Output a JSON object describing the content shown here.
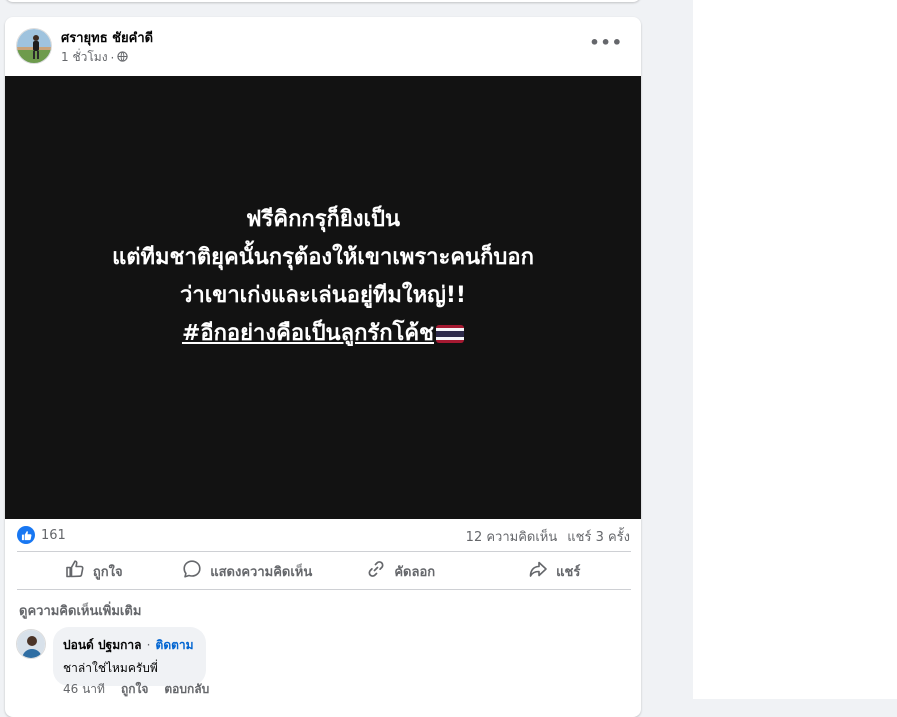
{
  "post": {
    "author": "ศรายุทธ ชัยคำดี",
    "time": "1 ชั่วโมง",
    "time_sep": "·",
    "audience_icon": "globe-icon",
    "more_icon": "more-horizontal-icon",
    "media_lines": [
      "ฟรีคิกกรุก็ยิงเป็น",
      "แต่ทีมชาติยุคนั้นกรุต้องให้เขาเพราะคนก็บอก",
      "ว่าเขาเก่งและเล่นอยู่ทีมใหญ่!!"
    ],
    "media_hashtag": "#อีกอย่างคือเป็นลูกรักโค้ช",
    "reaction_count": "161",
    "comments_count": "12 ความคิดเห็น",
    "shares_count": "แชร์ 3 ครั้ง"
  },
  "actions": {
    "like": "ถูกใจ",
    "comment": "แสดงความคิดเห็น",
    "copy": "คัดลอก",
    "share": "แชร์"
  },
  "comments": {
    "more_label": "ดูความคิดเห็นเพิ่มเติม",
    "items": [
      {
        "author": "ปอนด์ ปฐมกาล",
        "separator": "·",
        "follow": "ติดตาม",
        "text": "ชาล่าใช่ไหมครับพี่",
        "time": "46 นาที",
        "like": "ถูกใจ",
        "reply": "ตอบกลับ"
      }
    ]
  },
  "colors": {
    "accent": "#1877f2",
    "link": "#0064d1",
    "media_bg": "#121212",
    "page_bg": "#f0f2f5"
  }
}
